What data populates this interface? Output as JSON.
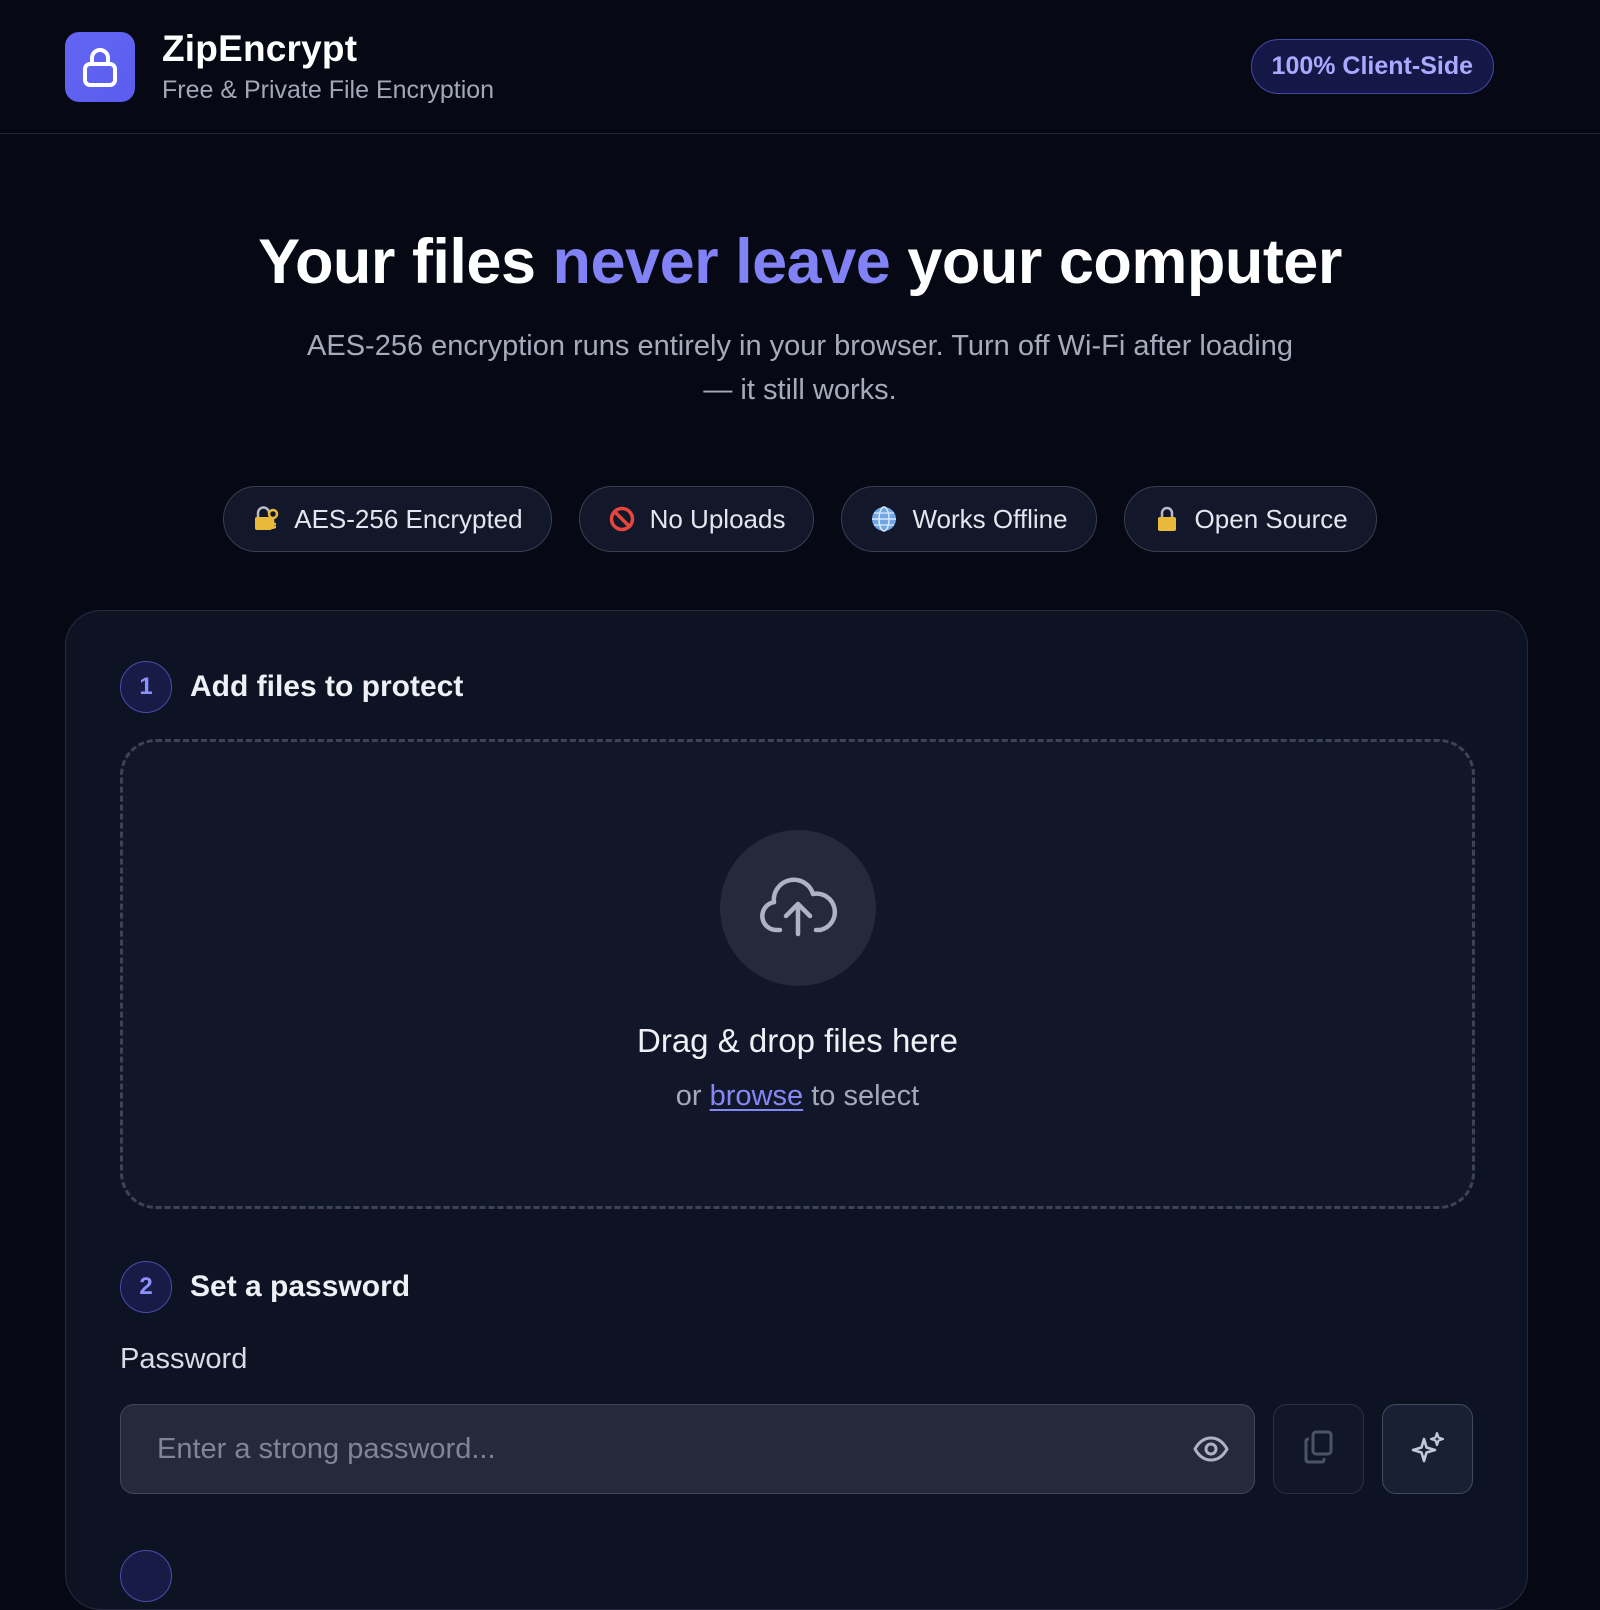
{
  "header": {
    "app_name": "ZipEncrypt",
    "tagline": "Free & Private File Encryption",
    "badge": "100% Client-Side",
    "logo_icon": "lock-icon"
  },
  "hero": {
    "title_part1": "Your files ",
    "title_accent": "never leave",
    "title_part2": " your computer",
    "description": "AES-256 encryption runs entirely in your browser. Turn off Wi-Fi after loading — it still works."
  },
  "features": [
    {
      "icon": "locked-with-key-icon",
      "label": "AES-256 Encrypted"
    },
    {
      "icon": "prohibited-icon",
      "label": "No Uploads"
    },
    {
      "icon": "globe-icon",
      "label": "Works Offline"
    },
    {
      "icon": "padlock-icon",
      "label": "Open Source"
    }
  ],
  "step1": {
    "number": "1",
    "title": "Add files to protect",
    "drop_title": "Drag & drop files here",
    "drop_or": "or ",
    "browse_link": "browse",
    "drop_suffix": " to select"
  },
  "step2": {
    "number": "2",
    "title": "Set a password",
    "password_label": "Password",
    "password_placeholder": "Enter a strong password...",
    "password_value": ""
  },
  "colors": {
    "background": "#060814",
    "card": "#0e1324",
    "accent": "#8182f6",
    "brand": "#6366f1"
  }
}
